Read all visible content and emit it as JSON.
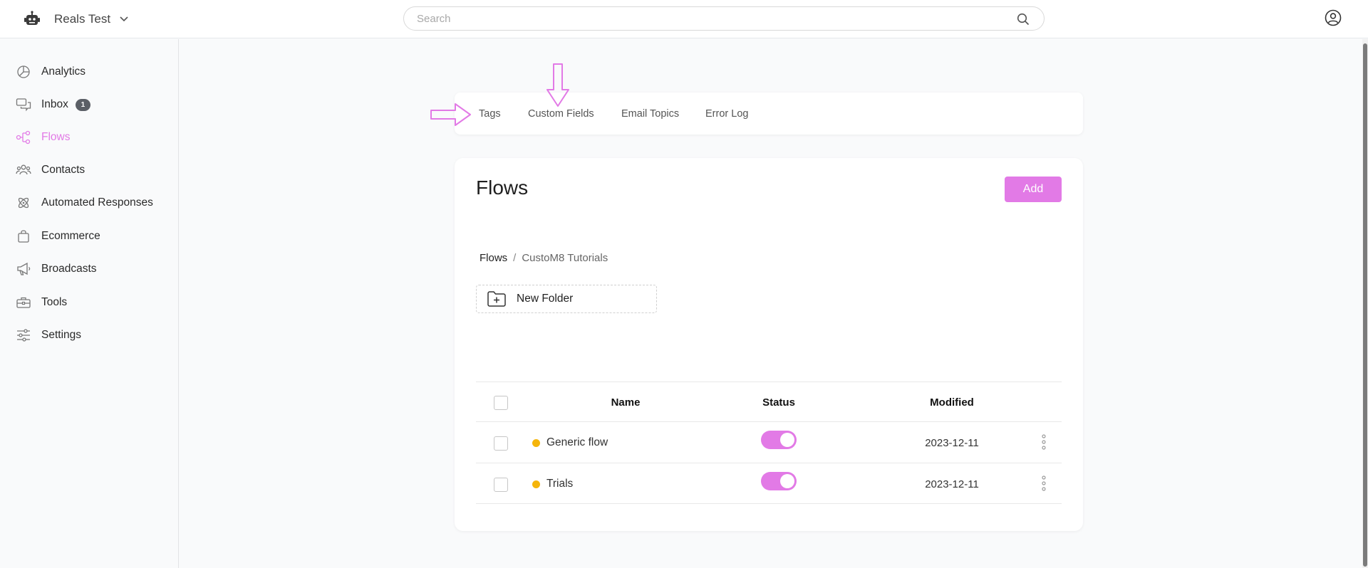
{
  "header": {
    "workspace_name": "Reals Test",
    "search_placeholder": "Search"
  },
  "sidebar": {
    "items": [
      {
        "label": "Analytics",
        "icon": "analytics-icon"
      },
      {
        "label": "Inbox",
        "icon": "inbox-icon",
        "badge": "1"
      },
      {
        "label": "Flows",
        "icon": "flows-icon",
        "active": true
      },
      {
        "label": "Contacts",
        "icon": "contacts-icon"
      },
      {
        "label": "Automated Responses",
        "icon": "automated-responses-icon"
      },
      {
        "label": "Ecommerce",
        "icon": "ecommerce-icon"
      },
      {
        "label": "Broadcasts",
        "icon": "broadcasts-icon"
      },
      {
        "label": "Tools",
        "icon": "tools-icon"
      },
      {
        "label": "Settings",
        "icon": "settings-icon"
      }
    ]
  },
  "tabs": [
    "Tags",
    "Custom Fields",
    "Email Topics",
    "Error Log"
  ],
  "main": {
    "title": "Flows",
    "add_label": "Add",
    "breadcrumb": {
      "root": "Flows",
      "separator": "/",
      "current": "CustoM8 Tutorials"
    },
    "new_folder_label": "New Folder",
    "table": {
      "headers": {
        "name": "Name",
        "status": "Status",
        "modified": "Modified"
      },
      "rows": [
        {
          "name": "Generic flow",
          "status": "on",
          "modified": "2023-12-11"
        },
        {
          "name": "Trials",
          "status": "on",
          "modified": "2023-12-11"
        }
      ]
    }
  },
  "colors": {
    "accent": "#e27ae6",
    "status_dot": "#f5b50b",
    "badge": "#5b5f66"
  }
}
